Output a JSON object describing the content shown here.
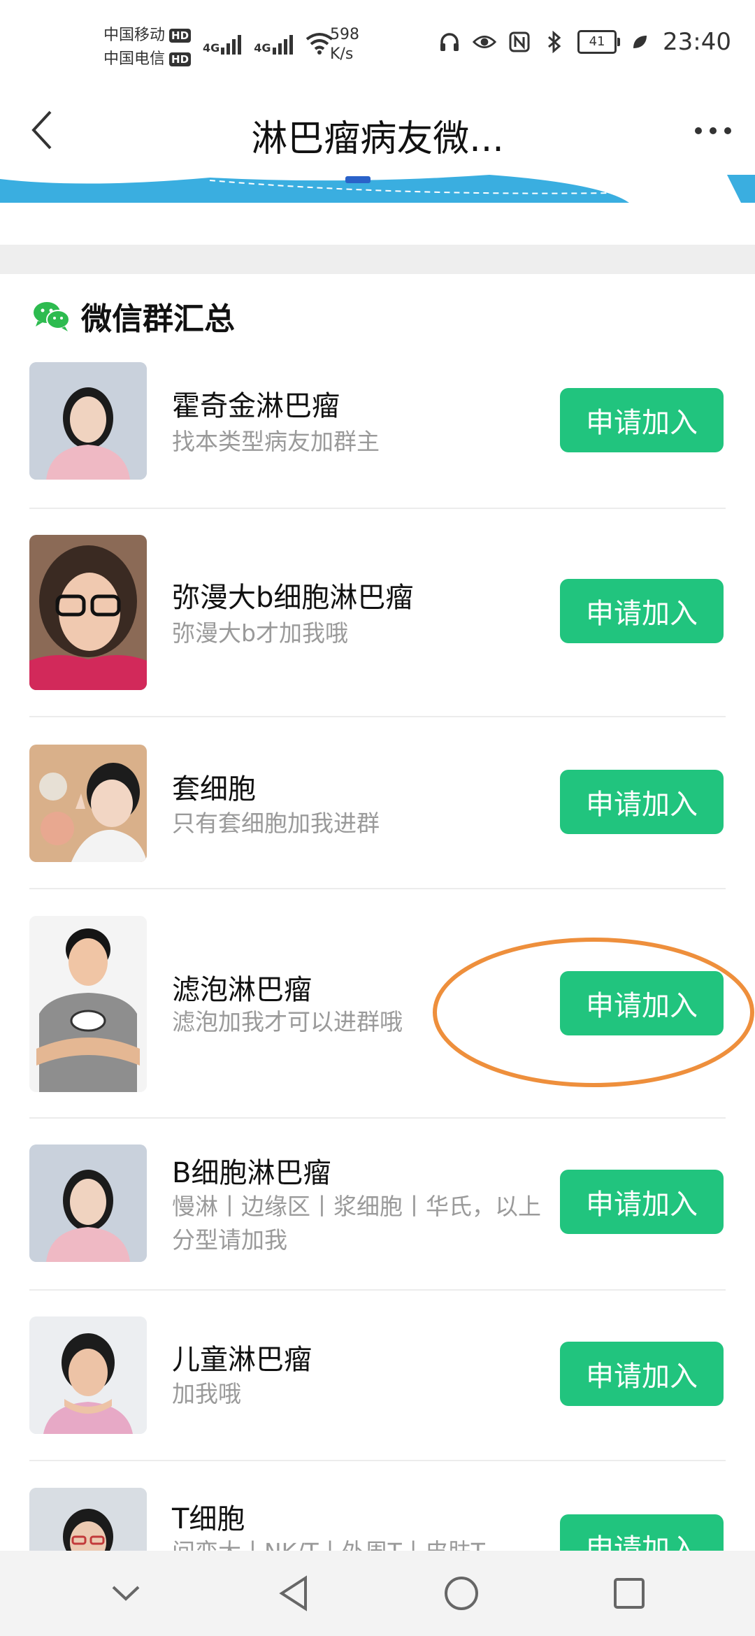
{
  "status_bar": {
    "carrier1": "中国移动",
    "carrier2": "中国电信",
    "hd": "HD",
    "net1": "4G",
    "net2": "4G",
    "speed_value": "598",
    "speed_unit": "K/s",
    "battery": "41",
    "time": "23:40"
  },
  "header": {
    "title": "淋巴瘤病友微...",
    "back_icon": "chevron-left-icon",
    "more_icon": "more-horizontal-icon"
  },
  "section": {
    "title": "微信群汇总",
    "icon": "wechat-icon",
    "icon_color": "#2dbb4f"
  },
  "groups": [
    {
      "name": "霍奇金淋巴瘤",
      "desc": "找本类型病友加群主",
      "button": "申请加入"
    },
    {
      "name": "弥漫大b细胞淋巴瘤",
      "desc": "弥漫大b才加我哦",
      "button": "申请加入"
    },
    {
      "name": "套细胞",
      "desc": "只有套细胞加我进群",
      "button": "申请加入"
    },
    {
      "name": "滤泡淋巴瘤",
      "desc": "滤泡加我才可以进群哦",
      "button": "申请加入"
    },
    {
      "name": "B细胞淋巴瘤",
      "desc": "慢淋丨边缘区丨浆细胞丨华氏，以上分型请加我",
      "button": "申请加入"
    },
    {
      "name": "儿童淋巴瘤",
      "desc": "加我哦",
      "button": "申请加入"
    },
    {
      "name": "T细胞",
      "desc": "间变大丨NK/T丨外周T丨皮肤T",
      "button": "申请加入"
    }
  ],
  "colors": {
    "button_green": "#21c47e",
    "annotation_orange": "#ee8f3c",
    "banner_blue": "#3aaee0"
  },
  "nav_bar": {
    "icons": [
      "chevron-down-icon",
      "back-triangle-icon",
      "home-circle-icon",
      "recents-square-icon"
    ]
  }
}
